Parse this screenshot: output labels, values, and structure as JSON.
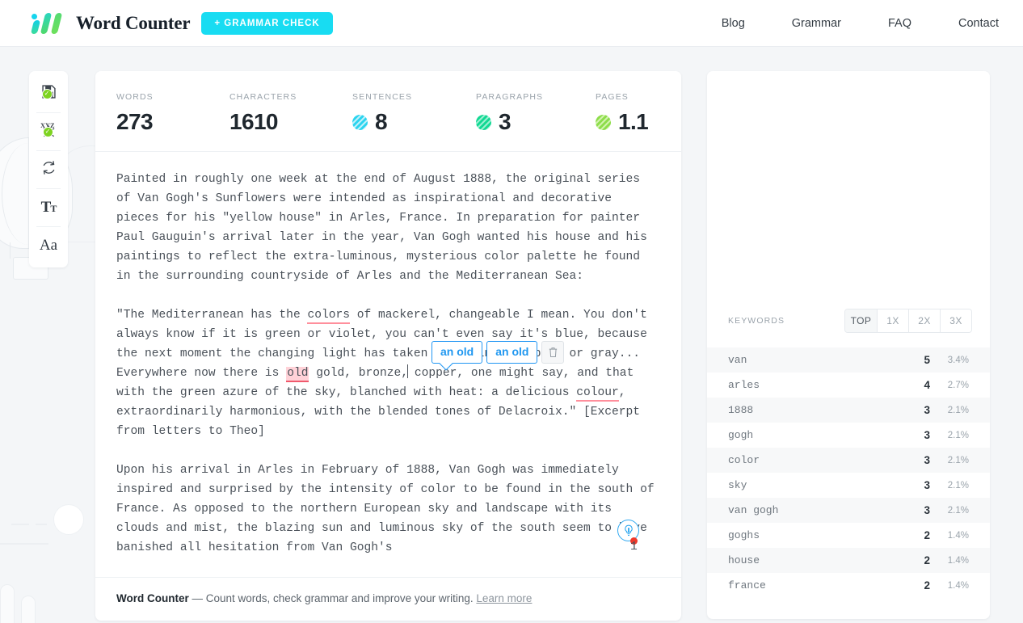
{
  "header": {
    "brand_title": "Word Counter",
    "grammar_button": "+ GRAMMAR CHECK",
    "nav": [
      {
        "label": "Blog"
      },
      {
        "label": "Grammar"
      },
      {
        "label": "FAQ"
      },
      {
        "label": "Contact"
      }
    ]
  },
  "rail": {
    "items": [
      {
        "name": "save-document",
        "icon": "floppy-disk-icon",
        "badge": "✓"
      },
      {
        "name": "spell-check",
        "icon": "xyz-spellcheck-icon",
        "badge": "✓"
      },
      {
        "name": "sync-refresh",
        "icon": "refresh-icon",
        "badge": ""
      },
      {
        "name": "text-case",
        "icon": "text-size-icon",
        "badge": ""
      },
      {
        "name": "font-style",
        "icon": "font-aa-icon",
        "badge": ""
      }
    ]
  },
  "stats": [
    {
      "label": "WORDS",
      "value": "273",
      "dot": "none"
    },
    {
      "label": "CHARACTERS",
      "value": "1610",
      "dot": "none"
    },
    {
      "label": "SENTENCES",
      "value": "8",
      "dot": "cyan"
    },
    {
      "label": "PARAGRAPHS",
      "value": "3",
      "dot": "green"
    },
    {
      "label": "PAGES",
      "value": "1.1",
      "dot": "lime"
    }
  ],
  "document": {
    "p1": "Painted in roughly one week at the end of August 1888, the original series of Van Gogh's Sunflowers were intended as inspirational and decorative pieces for his \"yellow house\" in Arles, France. In preparation for painter Paul Gauguin's arrival later in the year, Van Gogh wanted his house and his paintings to reflect the extra-luminous, mysterious color palette he found in the surrounding countryside of Arles and the Mediterranean Sea:",
    "p2_a": "\"The Mediterranean has the ",
    "p2_err1": "colors",
    "p2_b": " of mackerel, changeable I mean. You don't always know if it is green or violet, you can't even say it's blue, because the next moment the changing light has taken on a tinge of pink or gray... Everywhere now there is ",
    "p2_err2": "old",
    "p2_c": " gold, bronze,",
    "p2_d": " copper, one might say, and that with the green azure of the sky, blanched with heat: a delicious ",
    "p2_err3": "colour",
    "p2_e": ", extraordinarily harmonious, with the blended tones of Delacroix.\" [Excerpt from letters to Theo]",
    "p3": "Upon his arrival in Arles in February of 1888, Van Gogh was immediately inspired and surprised by the intensity of color to be found in the south of France. As opposed to the northern European sky and landscape with its clouds and mist, the blazing sun and luminous sky of the south seem to have banished all hesitation from Van Gogh's"
  },
  "suggestion": {
    "option_1": "an old",
    "option_2": "an old",
    "delete_icon": "trash-icon"
  },
  "assist": {
    "icon": "lightbulb-icon",
    "notification": "1"
  },
  "footer": {
    "brand": "Word Counter",
    "text": " — Count words, check grammar and improve your writing. ",
    "link": "Learn more"
  },
  "keywords_panel": {
    "title": "KEYWORDS",
    "filters": [
      {
        "label": "TOP",
        "active": true
      },
      {
        "label": "1X",
        "active": false
      },
      {
        "label": "2X",
        "active": false
      },
      {
        "label": "3X",
        "active": false
      }
    ],
    "rows": [
      {
        "word": "van",
        "count": "5",
        "pct": "3.4%"
      },
      {
        "word": "arles",
        "count": "4",
        "pct": "2.7%"
      },
      {
        "word": "1888",
        "count": "3",
        "pct": "2.1%"
      },
      {
        "word": "gogh",
        "count": "3",
        "pct": "2.1%"
      },
      {
        "word": "color",
        "count": "3",
        "pct": "2.1%"
      },
      {
        "word": "sky",
        "count": "3",
        "pct": "2.1%"
      },
      {
        "word": "van gogh",
        "count": "3",
        "pct": "2.1%"
      },
      {
        "word": "goghs",
        "count": "2",
        "pct": "1.4%"
      },
      {
        "word": "house",
        "count": "2",
        "pct": "1.4%"
      },
      {
        "word": "france",
        "count": "2",
        "pct": "1.4%"
      }
    ]
  },
  "colors": {
    "accent_cyan": "#18dcf2",
    "accent_green": "#7ed321",
    "suggest_blue": "#2196f3",
    "error_red": "#f0596c",
    "page_bg": "#f4f6f8"
  }
}
